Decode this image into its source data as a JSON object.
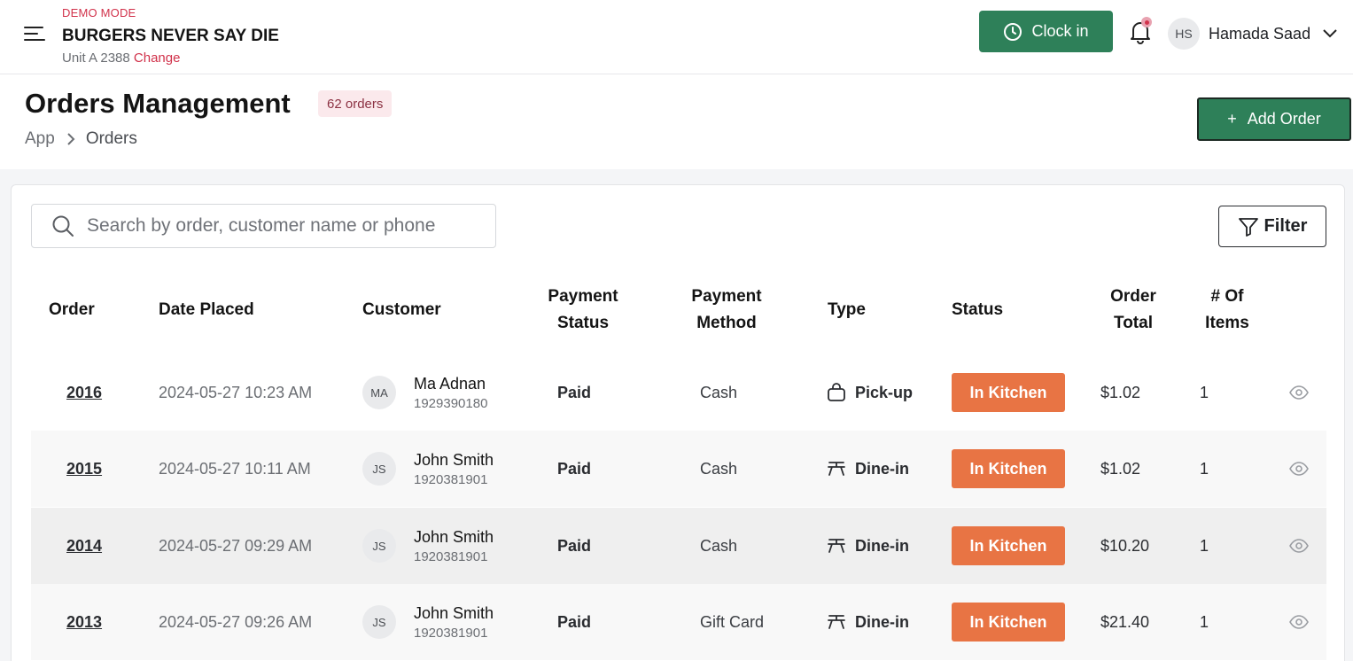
{
  "header": {
    "demo_label": "DEMO MODE",
    "brand_name": "BURGERS NEVER SAY DIE",
    "unit_label": "Unit A 2388",
    "change_link": "Change",
    "clock_in_label": "Clock in",
    "user_initials": "HS",
    "user_name": "Hamada Saad"
  },
  "page": {
    "title": "Orders Management",
    "order_count_badge": "62 orders",
    "breadcrumb": [
      "App",
      "Orders"
    ],
    "add_order_label": "Add Order",
    "add_order_symbol": "+"
  },
  "toolbar": {
    "search_placeholder": "Search by order, customer name or phone",
    "filter_label": "Filter"
  },
  "table": {
    "headers": {
      "order": "Order",
      "date_placed": "Date Placed",
      "customer": "Customer",
      "payment_status_1": "Payment",
      "payment_status_2": "Status",
      "payment_method_1": "Payment",
      "payment_method_2": "Method",
      "type": "Type",
      "status": "Status",
      "order_total_1": "Order",
      "order_total_2": "Total",
      "items_1": "# Of",
      "items_2": "Items"
    },
    "rows": [
      {
        "order": "2016",
        "date": "2024-05-27 10:23 AM",
        "initials": "MA",
        "name": "Ma Adnan",
        "phone": "1929390180",
        "payment_status": "Paid",
        "payment_method": "Cash",
        "type": "Pick-up",
        "type_icon": "bag-icon",
        "status": "In Kitchen",
        "total": "$1.02",
        "items": "1",
        "background": "#ffffff"
      },
      {
        "order": "2015",
        "date": "2024-05-27 10:11 AM",
        "initials": "JS",
        "name": "John Smith",
        "phone": "1920381901",
        "payment_status": "Paid",
        "payment_method": "Cash",
        "type": "Dine-in",
        "type_icon": "table-icon",
        "status": "In Kitchen",
        "total": "$1.02",
        "items": "1",
        "background": "#f8f8f8"
      },
      {
        "order": "2014",
        "date": "2024-05-27 09:29 AM",
        "initials": "JS",
        "name": "John Smith",
        "phone": "1920381901",
        "payment_status": "Paid",
        "payment_method": "Cash",
        "type": "Dine-in",
        "type_icon": "table-icon",
        "status": "In Kitchen",
        "total": "$10.20",
        "items": "1",
        "background": "#efefef"
      },
      {
        "order": "2013",
        "date": "2024-05-27 09:26 AM",
        "initials": "JS",
        "name": "John Smith",
        "phone": "1920381901",
        "payment_status": "Paid",
        "payment_method": "Gift Card",
        "type": "Dine-in",
        "type_icon": "table-icon",
        "status": "In Kitchen",
        "total": "$21.40",
        "items": "1",
        "background": "#f8f8f8"
      }
    ]
  },
  "colors": {
    "primary_green": "#2e8059",
    "status_orange": "#e87444",
    "accent_red": "#d1324b"
  }
}
